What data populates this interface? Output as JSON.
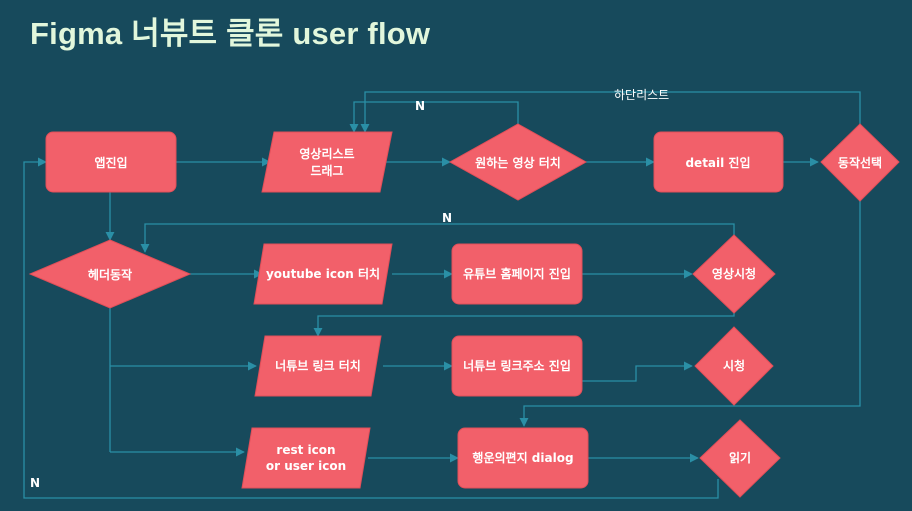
{
  "title": "Figma 너뷰트 클론 user flow",
  "colors": {
    "background": "#174a5c",
    "node": "#f2606a",
    "edge": "#2a8fa6",
    "title": "#e2f7dc"
  },
  "nodes": {
    "app_enter": "앱진입",
    "video_list_drag": [
      "영상리스트",
      "드래그"
    ],
    "touch_wanted_video": "원하는 영상 터치",
    "detail_enter": "detail 진입",
    "action_select": "동작선택",
    "header_action": "헤더동작",
    "youtube_icon_touch": "youtube icon 터치",
    "youtube_home_enter": "유튜브 홈페이지 진입",
    "video_watch": "영상시청",
    "nertube_link_touch": "너튜브 링크 터치",
    "nertube_link_enter": "너튜브 링크주소 진입",
    "watch": "시청",
    "rest_user_icon": [
      "rest icon",
      "or user icon"
    ],
    "fortune_letter_dialog": "행운의편지 dialog",
    "read": "읽기"
  },
  "edge_labels": {
    "n_top": "N",
    "bottom_list": "하단리스트",
    "n_middle": "N",
    "n_bottom": "N"
  }
}
